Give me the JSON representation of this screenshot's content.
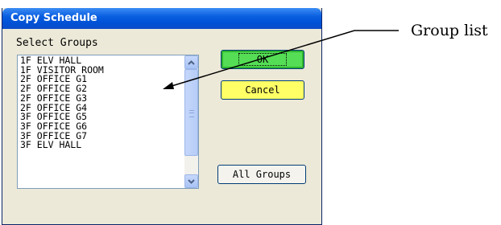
{
  "dialog": {
    "title": "Copy Schedule",
    "select_label": "Select Groups",
    "groups": [
      "1F ELV HALL",
      "1F VISITOR ROOM",
      "2F OFFICE G1",
      "2F OFFICE G2",
      "2F OFFICE G3",
      "2F OFFICE G4",
      "3F OFFICE G5",
      "3F OFFICE G6",
      "3F OFFICE G7",
      "3F ELV HALL"
    ],
    "ok_label": "OK",
    "cancel_label": "Cancel",
    "all_groups_label": "All Groups",
    "ok_color": "#55dd55",
    "cancel_color": "#ffff66"
  },
  "annotation": {
    "label": "Group list"
  }
}
